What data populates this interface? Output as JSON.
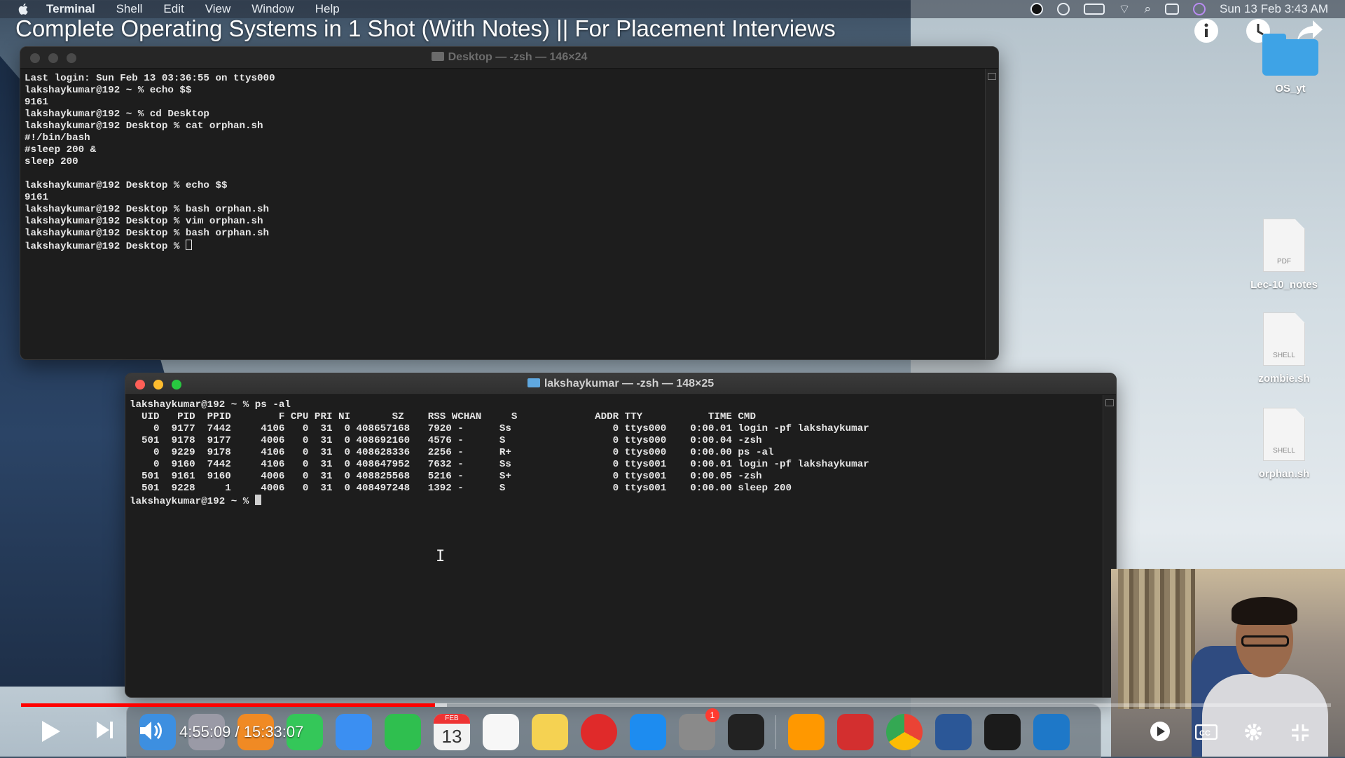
{
  "menubar": {
    "items": [
      "Terminal",
      "Shell",
      "Edit",
      "View",
      "Window",
      "Help"
    ],
    "datetime": "Sun 13 Feb  3:43 AM"
  },
  "video": {
    "title": "Complete Operating Systems in 1 Shot (With Notes) || For Placement Interviews",
    "time": "4:55:09 / 15:33:07",
    "progress_fraction": 0.316,
    "loaded_fraction": 0.325,
    "accent": "#ff0000"
  },
  "desktop": {
    "icons": [
      {
        "label": "OS_yt",
        "type": "folder"
      },
      {
        "label": "Lec-10_notes",
        "type": "PDF"
      },
      {
        "label": "zombie.sh",
        "type": "SHELL"
      },
      {
        "label": "orphan.sh",
        "type": "SHELL"
      }
    ]
  },
  "terminal_back": {
    "title": "Desktop — -zsh — 146×24",
    "content": "Last login: Sun Feb 13 03:36:55 on ttys000\nlakshaykumar@192 ~ % echo $$\n9161\nlakshaykumar@192 ~ % cd Desktop\nlakshaykumar@192 Desktop % cat orphan.sh\n#!/bin/bash\n#sleep 200 &\nsleep 200\n\nlakshaykumar@192 Desktop % echo $$\n9161\nlakshaykumar@192 Desktop % bash orphan.sh\nlakshaykumar@192 Desktop % vim orphan.sh\nlakshaykumar@192 Desktop % bash orphan.sh\nlakshaykumar@192 Desktop % "
  },
  "terminal_front": {
    "title": "lakshaykumar — -zsh — 148×25",
    "content": "lakshaykumar@192 ~ % ps -al\n  UID   PID  PPID        F CPU PRI NI       SZ    RSS WCHAN     S             ADDR TTY           TIME CMD\n    0  9177  7442     4106   0  31  0 408657168   7920 -      Ss                 0 ttys000    0:00.01 login -pf lakshaykumar\n  501  9178  9177     4006   0  31  0 408692160   4576 -      S                  0 ttys000    0:00.04 -zsh\n    0  9229  9178     4106   0  31  0 408628336   2256 -      R+                 0 ttys000    0:00.00 ps -al\n    0  9160  7442     4106   0  31  0 408647952   7632 -      Ss                 0 ttys001    0:00.01 login -pf lakshaykumar\n  501  9161  9160     4006   0  31  0 408825568   5216 -      S+                 0 ttys001    0:00.05 -zsh\n  501  9228     1     4006   0  31  0 408497248   1392 -      S                  0 ttys001    0:00.00 sleep 200\nlakshaykumar@192 ~ % "
  },
  "dock": {
    "apps": [
      {
        "name": "finder-icon",
        "color": "#3d8fe0"
      },
      {
        "name": "launchpad-icon",
        "color": "#9a9aa6"
      },
      {
        "name": "firefox-icon",
        "color": "#f08a24"
      },
      {
        "name": "messages-icon",
        "color": "#34c759"
      },
      {
        "name": "mail-icon",
        "color": "#3b8ff2"
      },
      {
        "name": "facetime-icon",
        "color": "#2fbf4f"
      },
      {
        "name": "calendar-icon",
        "color": "#f2f2f2"
      },
      {
        "name": "reminders-icon",
        "color": "#f7f7f7"
      },
      {
        "name": "notes-icon",
        "color": "#f5d252"
      },
      {
        "name": "screen-recorder-icon",
        "color": "#e02a2a"
      },
      {
        "name": "app-store-icon",
        "color": "#1d8cf0"
      },
      {
        "name": "system-preferences-icon",
        "color": "#8a8a8a"
      },
      {
        "name": "tradingview-icon",
        "color": "#222222"
      },
      {
        "name": "sublime-text-icon",
        "color": "#ff9800"
      },
      {
        "name": "acrobat-icon",
        "color": "#d32f2f"
      },
      {
        "name": "chrome-icon",
        "color": "#4285f4"
      },
      {
        "name": "word-icon",
        "color": "#2b5797"
      },
      {
        "name": "terminal-icon",
        "color": "#1b1b1b"
      },
      {
        "name": "quicktime-icon",
        "color": "#1e78c8"
      }
    ],
    "calendar_month": "FEB",
    "calendar_day": "13",
    "settings_badge": "1"
  }
}
